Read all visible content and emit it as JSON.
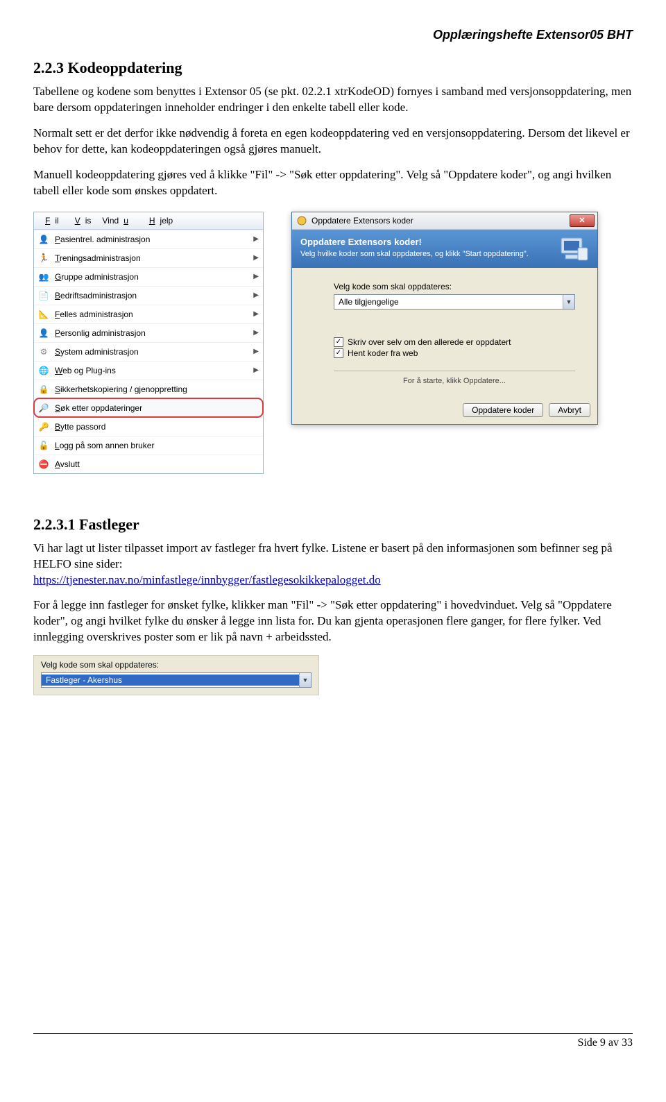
{
  "header": {
    "doc_title": "Opplæringshefte Extensor05 BHT"
  },
  "section1": {
    "heading": "2.2.3 Kodeoppdatering",
    "p1": "Tabellene og kodene som benyttes i Extensor 05 (se pkt. 02.2.1 xtrKodeOD) fornyes i samband med versjonsoppdatering, men bare dersom oppdateringen inneholder endringer i den enkelte tabell eller kode.",
    "p2": "Normalt sett er det derfor ikke nødvendig å foreta en egen kodeoppdatering ved en versjonsoppdatering. Dersom det likevel er behov for dette, kan kodeoppdateringen også gjøres manuelt.",
    "p3": "Manuell kodeoppdatering gjøres ved å klikke \"Fil\" -> \"Søk etter oppdatering\". Velg så \"Oppdatere koder\", og angi hvilken tabell eller kode som ønskes oppdatert."
  },
  "menu": {
    "bar": {
      "fil": "Fil",
      "vis": "Vis",
      "vindu": "Vindu",
      "hjelp": "Hjelp"
    },
    "items": [
      {
        "label": "Pasientrel. administrasjon",
        "arrow": true
      },
      {
        "label": "Treningsadministrasjon",
        "arrow": true
      },
      {
        "label": "Gruppe administrasjon",
        "arrow": true
      },
      {
        "label": "Bedriftsadministrasjon",
        "arrow": true
      },
      {
        "label": "Felles administrasjon",
        "arrow": true
      },
      {
        "label": "Personlig administrasjon",
        "arrow": true
      },
      {
        "label": "System administrasjon",
        "arrow": true
      },
      {
        "label": "Web og Plug-ins",
        "arrow": true
      },
      {
        "label": "Sikkerhetskopiering / gjenoppretting",
        "arrow": false
      },
      {
        "label": "Søk etter oppdateringer",
        "arrow": false,
        "highlight": true
      },
      {
        "label": "Bytte passord",
        "arrow": false
      },
      {
        "label": "Logg på som annen bruker",
        "arrow": false
      },
      {
        "label": "Avslutt",
        "arrow": false
      }
    ]
  },
  "dialog": {
    "title": "Oppdatere Extensors koder",
    "banner_heading": "Oppdatere Extensors koder!",
    "banner_sub": "Velg hvilke koder som skal oppdateres, og klikk \"Start oppdatering\".",
    "field_label": "Velg kode som skal oppdateres:",
    "combo_value": "Alle tilgjengelige",
    "chk1": "Skriv over selv om den allerede er oppdatert",
    "chk2": "Hent koder fra web",
    "hint": "For å starte, klikk Oppdatere...",
    "btn_update": "Oppdatere koder",
    "btn_cancel": "Avbryt"
  },
  "section2": {
    "heading": "2.2.3.1 Fastleger",
    "p1a": "Vi har lagt ut lister tilpasset import av fastleger fra hvert fylke. Listene er basert på den informasjonen som befinner seg på HELFO sine sider:",
    "link": "https://tjenester.nav.no/minfastlege/innbygger/fastlegesokikkepalogget.do",
    "p2": "For å legge inn fastleger for ønsket fylke, klikker man \"Fil\" -> \"Søk etter oppdatering\" i hovedvinduet. Velg så \"Oppdatere koder\", og angi hvilket fylke du ønsker å legge inn lista for. Du kan gjenta operasjonen flere ganger, for flere fylker. Ved innlegging overskrives poster som er lik på navn + arbeidssted."
  },
  "small_combo": {
    "label": "Velg kode som skal oppdateres:",
    "value": "Fastleger - Akershus"
  },
  "footer": {
    "page": "Side 9 av 33"
  }
}
